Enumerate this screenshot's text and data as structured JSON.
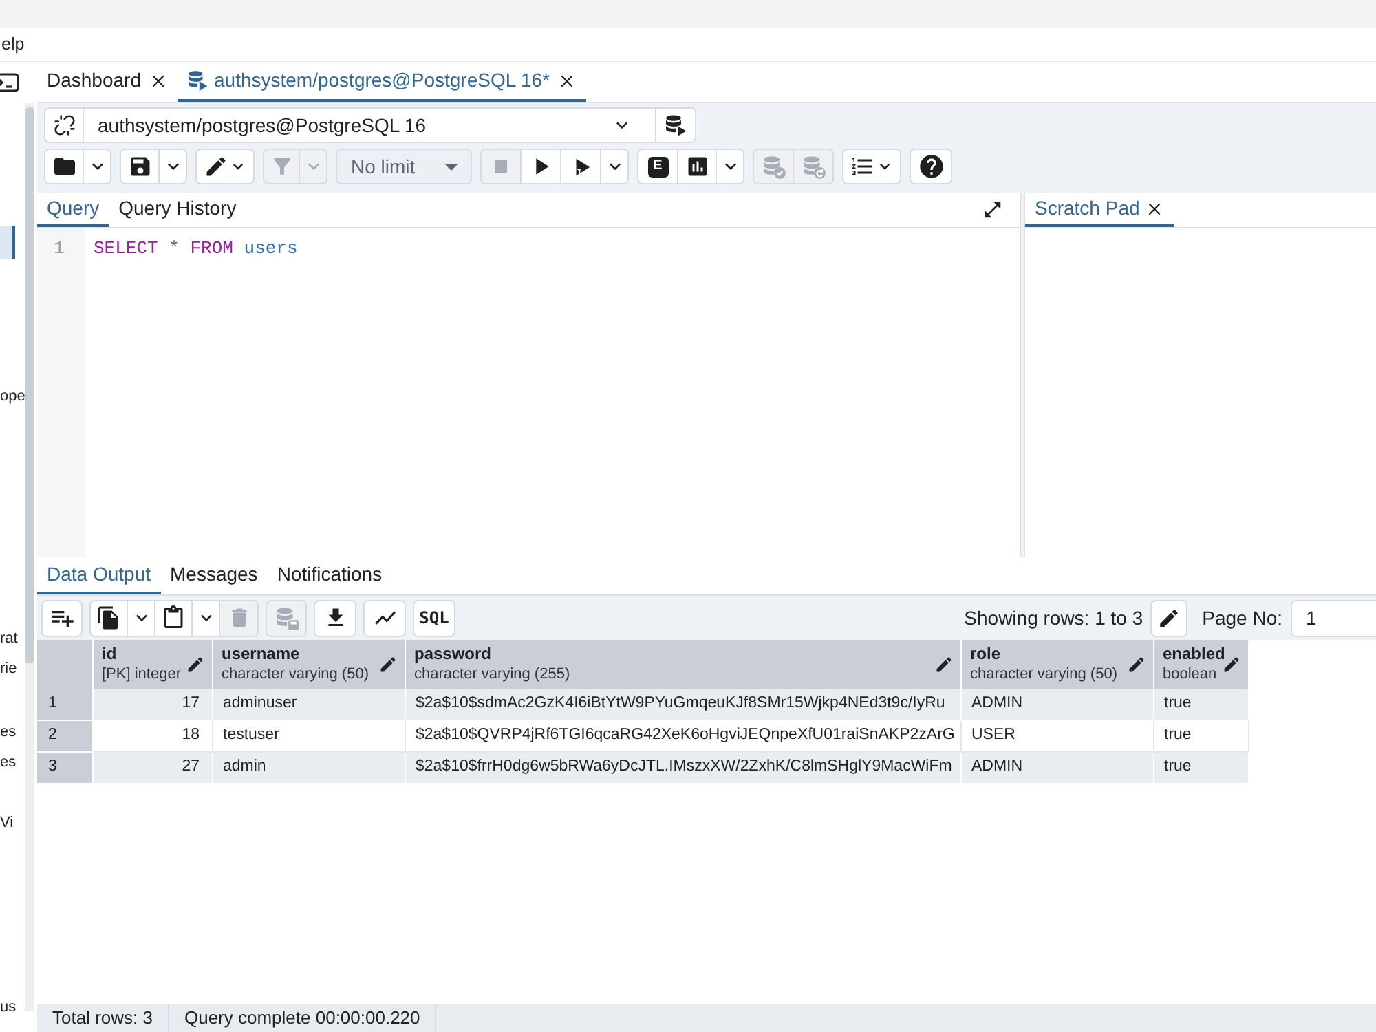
{
  "menu_bar": {
    "items": [
      "elp"
    ]
  },
  "sidebar": {
    "items": [
      {
        "selected": true
      },
      {
        "label": "ope",
        "selected": false
      },
      {
        "label": "rat",
        "selected": false
      },
      {
        "label": "rie",
        "selected": false
      },
      {
        "label": "es",
        "selected": false
      },
      {
        "label": "es",
        "selected": false
      },
      {
        "label": "Vi",
        "selected": false
      },
      {
        "label": "us",
        "selected": false
      }
    ]
  },
  "tabs": [
    {
      "label": "Dashboard",
      "kind": "dashboard",
      "selected": false
    },
    {
      "label": "authsystem/postgres@PostgreSQL 16*",
      "kind": "query_tool",
      "selected": true
    }
  ],
  "connection": {
    "value": "authsystem/postgres@PostgreSQL 16"
  },
  "query_toolbar": {
    "groups": [
      {
        "buttons": [
          {
            "kind": "open",
            "disabled": false
          },
          {
            "kind": "dropdown",
            "disabled": false
          }
        ]
      },
      {
        "buttons": [
          {
            "kind": "save",
            "disabled": false
          },
          {
            "kind": "dropdown",
            "disabled": false
          }
        ]
      },
      {
        "buttons": [
          {
            "kind": "edit_menu",
            "disabled": false
          }
        ]
      },
      {
        "buttons": [
          {
            "kind": "filter",
            "disabled": true
          },
          {
            "kind": "dropdown",
            "disabled": true
          }
        ]
      },
      {
        "buttons": [
          {
            "kind": "row_limit",
            "label": "No limit",
            "disabled": false
          }
        ]
      },
      {
        "buttons": [
          {
            "kind": "stop",
            "disabled": true
          },
          {
            "kind": "execute",
            "disabled": false
          },
          {
            "kind": "execute_script",
            "disabled": false
          },
          {
            "kind": "dropdown",
            "disabled": false
          }
        ]
      },
      {
        "buttons": [
          {
            "kind": "explain",
            "label": "E",
            "disabled": false
          },
          {
            "kind": "explain_analyze",
            "disabled": false
          },
          {
            "kind": "dropdown",
            "disabled": false
          }
        ]
      },
      {
        "buttons": [
          {
            "kind": "commit",
            "disabled": true
          },
          {
            "kind": "rollback",
            "disabled": true
          }
        ]
      },
      {
        "buttons": [
          {
            "kind": "macros",
            "disabled": false
          }
        ]
      },
      {
        "buttons": [
          {
            "kind": "help",
            "disabled": false
          }
        ]
      }
    ]
  },
  "editor": {
    "tabs": [
      {
        "label": "Query",
        "selected": true
      },
      {
        "label": "Query History",
        "selected": false
      }
    ],
    "lines": [
      {
        "number": "1",
        "tokens": [
          {
            "text": "SELECT",
            "kind": "keyword"
          },
          {
            "text": "*",
            "kind": "operator"
          },
          {
            "text": "FROM",
            "kind": "keyword"
          },
          {
            "text": "users",
            "kind": "identifier"
          }
        ]
      }
    ]
  },
  "scratch_pad": {
    "tabs": [
      {
        "label": "Scratch Pad",
        "selected": true
      }
    ]
  },
  "results": {
    "tabs": [
      {
        "label": "Data Output",
        "selected": true
      },
      {
        "label": "Messages",
        "selected": false
      },
      {
        "label": "Notifications",
        "selected": false
      }
    ],
    "toolbar": {
      "groups": [
        {
          "buttons": [
            {
              "kind": "add_row",
              "disabled": false
            }
          ]
        },
        {
          "buttons": [
            {
              "kind": "copy",
              "disabled": false
            },
            {
              "kind": "dropdown",
              "disabled": false
            },
            {
              "kind": "paste",
              "disabled": false
            },
            {
              "kind": "dropdown",
              "disabled": false
            },
            {
              "kind": "delete",
              "disabled": true
            }
          ]
        },
        {
          "buttons": [
            {
              "kind": "save_data",
              "disabled": true
            }
          ]
        },
        {
          "buttons": [
            {
              "kind": "download",
              "disabled": false
            }
          ]
        },
        {
          "buttons": [
            {
              "kind": "graph",
              "disabled": false
            }
          ]
        },
        {
          "buttons": [
            {
              "kind": "sql",
              "label": "SQL",
              "disabled": false
            }
          ]
        }
      ]
    },
    "pagination": {
      "summary": "Showing rows: 1 to 3",
      "page_label": "Page No:",
      "page_value": "1"
    },
    "table": {
      "columns": [
        {
          "name": "id",
          "type": "[PK] integer",
          "kind": "number"
        },
        {
          "name": "username",
          "type": "character varying (50)",
          "kind": "text"
        },
        {
          "name": "password",
          "type": "character varying (255)",
          "kind": "text"
        },
        {
          "name": "role",
          "type": "character varying (50)",
          "kind": "text"
        },
        {
          "name": "enabled",
          "type": "boolean",
          "kind": "boolean"
        }
      ],
      "rows": [
        {
          "number": "1",
          "cells": [
            "17",
            "adminuser",
            "$2a$10$sdmAc2GzK4I6iBtYtW9PYuGmqeuKJf8SMr15Wjkp4NEd3t9c/IyRu",
            "ADMIN",
            "true"
          ]
        },
        {
          "number": "2",
          "cells": [
            "18",
            "testuser",
            "$2a$10$QVRP4jRf6TGI6qcaRG42XeK6oHgviJEQnpeXfU01raiSnAKP2zArG",
            "USER",
            "true"
          ]
        },
        {
          "number": "3",
          "cells": [
            "27",
            "admin",
            "$2a$10$frrH0dg6w5bRWa6yDcJTL.IMszxXW/2ZxhK/C8lmSHglY9MacWiFm",
            "ADMIN",
            "true"
          ]
        }
      ]
    }
  },
  "status_bar": {
    "items": [
      "Total rows: 3",
      "Query complete 00:00:00.220"
    ]
  }
}
